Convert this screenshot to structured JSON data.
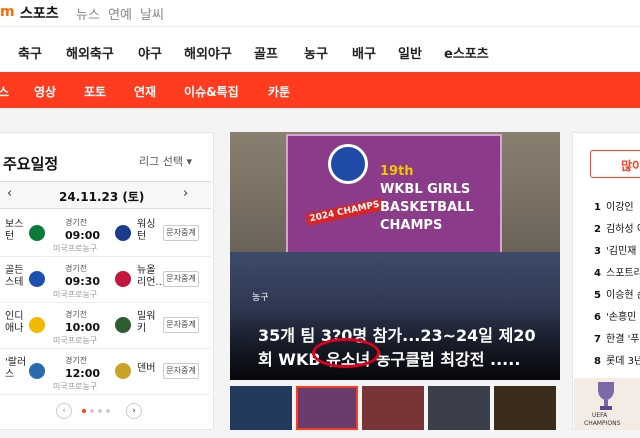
{
  "topbar": {
    "brand": "m",
    "brand_word": "스포츠",
    "services": [
      "뉴스",
      "연예",
      "날씨"
    ]
  },
  "sport_nav": [
    "축구",
    "해외축구",
    "야구",
    "해외야구",
    "골프",
    "농구",
    "배구",
    "일반",
    "e스포츠"
  ],
  "sub_nav": [
    "스",
    "영상",
    "포토",
    "연재",
    "이슈&특집",
    "카툰"
  ],
  "schedule": {
    "title": "주요일정",
    "league_select": "리그 선택",
    "date": "24.11.23 (토)",
    "prev": "‹",
    "next": "›",
    "games": [
      {
        "home": "보스\n턴",
        "away": "워싱\n턴",
        "kind": "경기전",
        "time": "09:00",
        "league": "미국프로농구",
        "button": "문자중계",
        "home_color": "#0a7a3a",
        "away_color": "#1b3b8f"
      },
      {
        "home": "골든\n스테",
        "away": "뉴올\n리언...",
        "kind": "경기전",
        "time": "09:30",
        "league": "미국프로농구",
        "button": "문자중계",
        "home_color": "#1d4fb0",
        "away_color": "#c4163a"
      },
      {
        "home": "인디\n애나",
        "away": "밀워\n키",
        "kind": "경기전",
        "time": "10:00",
        "league": "미국프로농구",
        "button": "문자중계",
        "home_color": "#f2b800",
        "away_color": "#2f5d2f"
      },
      {
        "home": "'랄러\n스",
        "away": "덴버",
        "kind": "경기전",
        "time": "12:00",
        "league": "미국프로농구",
        "button": "문자중계",
        "home_color": "#2a6bb0",
        "away_color": "#c9a227"
      }
    ]
  },
  "hero": {
    "banner_number": "19th",
    "banner_line1": "WKBL GIRLS",
    "banner_line2": "BASKETBALL",
    "banner_line3": "CHAMPS",
    "badge": "2024 CHAMPS",
    "tag": "농구",
    "caption_line1": "35개 팀 3?0명 참가...23~24일 제20",
    "caption_line2": "회 WKB  유소녀 농구클럽 최강전 ....."
  },
  "thumbs_colors": [
    "#233a5e",
    "#6a3c6e",
    "#7a3438",
    "#3b3f4a",
    "#3b2d1e"
  ],
  "right_panel": {
    "button": "많이",
    "ranks": [
      {
        "n": "1",
        "t": "이강인 "
      },
      {
        "n": "2",
        "t": "김하성 이"
      },
      {
        "n": "3",
        "t": "'김민재 휴"
      },
      {
        "n": "4",
        "t": "스포트라"
      },
      {
        "n": "5",
        "t": "이승현 손"
      },
      {
        "n": "6",
        "t": "'손흥민 이"
      },
      {
        "n": "7",
        "t": "한결 '푸이"
      },
      {
        "n": "8",
        "t": "롯데 3년"
      }
    ],
    "trophy_line1": "UEFA",
    "trophy_line2": "CHAMPIONS"
  }
}
